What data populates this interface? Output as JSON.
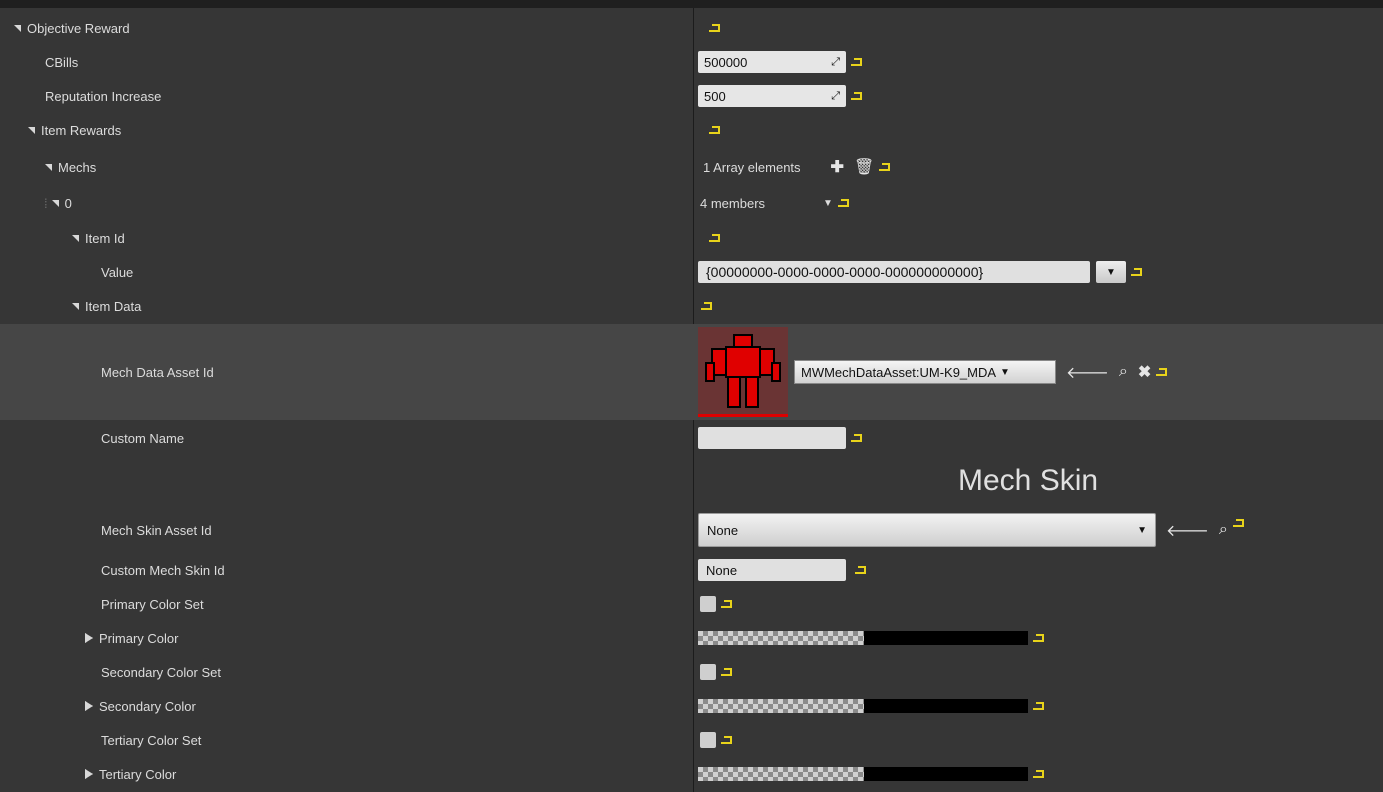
{
  "rows": {
    "objective_reward": "Objective Reward",
    "cbills": "CBills",
    "cbills_value": "500000",
    "reputation_increase": "Reputation Increase",
    "reputation_value": "500",
    "item_rewards": "Item Rewards",
    "mechs": "Mechs",
    "mechs_value": "1 Array elements",
    "index0": "0",
    "index0_value": "4 members",
    "item_id": "Item Id",
    "value": "Value",
    "value_guid": "{00000000-0000-0000-0000-000000000000}",
    "item_data": "Item Data",
    "mech_data_asset_id": "Mech Data Asset Id",
    "mech_data_asset_value": "MWMechDataAsset:UM-K9_MDA",
    "custom_name": "Custom Name",
    "mech_skin_header": "Mech Skin",
    "mech_skin_asset_id": "Mech Skin Asset Id",
    "mech_skin_asset_value": "None",
    "custom_mech_skin_id": "Custom Mech Skin Id",
    "custom_mech_skin_value": "None",
    "primary_color_set": "Primary Color Set",
    "primary_color": "Primary Color",
    "secondary_color_set": "Secondary Color Set",
    "secondary_color": "Secondary Color",
    "tertiary_color_set": "Tertiary Color Set",
    "tertiary_color": "Tertiary Color"
  },
  "icons": {
    "expanded": "triangle-down-icon",
    "collapsed": "triangle-right-icon",
    "reset": "reset-to-default-icon",
    "add": "plus-icon",
    "delete": "trash-icon",
    "browse": "arrow-left-icon",
    "search": "magnifier-icon",
    "clear": "close-icon"
  },
  "colors": {
    "background": "#363636",
    "highlight_row": "#464646",
    "reset_accent": "#e8d31a",
    "thumb_bg": "#6a3434",
    "mech_red": "#e00000"
  }
}
